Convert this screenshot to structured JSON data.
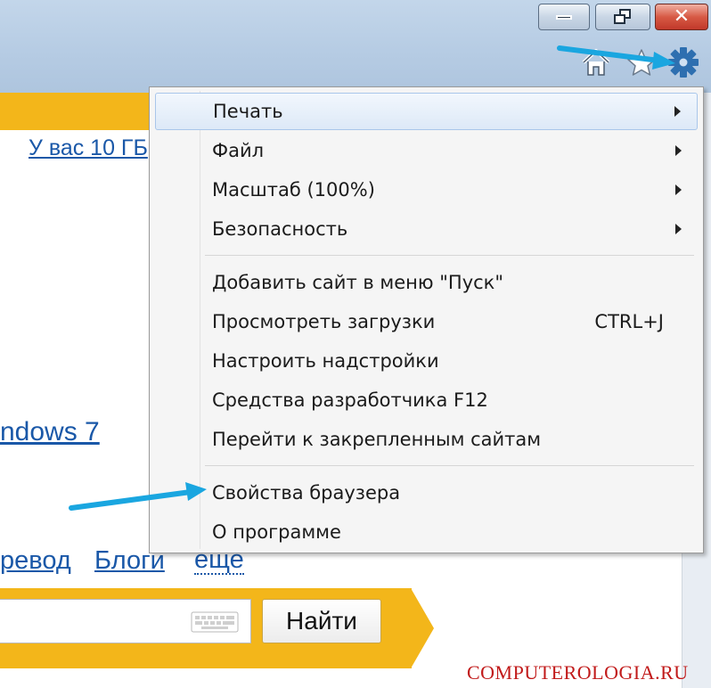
{
  "window_controls": {
    "minimize": "minimize",
    "maximize": "restore",
    "close": "close"
  },
  "toolbar": {
    "icons": [
      "home-icon",
      "star-icon",
      "gear-icon"
    ]
  },
  "page": {
    "storage_link": "У вас 10 ГБ",
    "windows_link": "ndows 7",
    "nav": {
      "translate": "ревод",
      "blogs": "Блоги",
      "more": "еще"
    },
    "search_button": "Найти",
    "watermark": "COMPUTEROLOGIA.RU"
  },
  "menu": {
    "items": [
      {
        "label": "Печать",
        "submenu": true,
        "highlighted": true
      },
      {
        "label": "Файл",
        "submenu": true
      },
      {
        "label": "Масштаб (100%)",
        "submenu": true
      },
      {
        "label": "Безопасность",
        "submenu": true
      },
      {
        "label": "Добавить сайт в меню \"Пуск\""
      },
      {
        "label": "Просмотреть загрузки",
        "shortcut": "CTRL+J"
      },
      {
        "label": "Настроить надстройки"
      },
      {
        "label": "Средства разработчика F12"
      },
      {
        "label": "Перейти к закрепленным сайтам"
      },
      {
        "label": "Свойства браузера"
      },
      {
        "label": "О программе"
      }
    ]
  },
  "colors": {
    "accent_yellow": "#f3b61a",
    "link_blue": "#1a58a8",
    "annotation_arrow": "#1aa6e0",
    "watermark_red": "#c11a1a"
  }
}
